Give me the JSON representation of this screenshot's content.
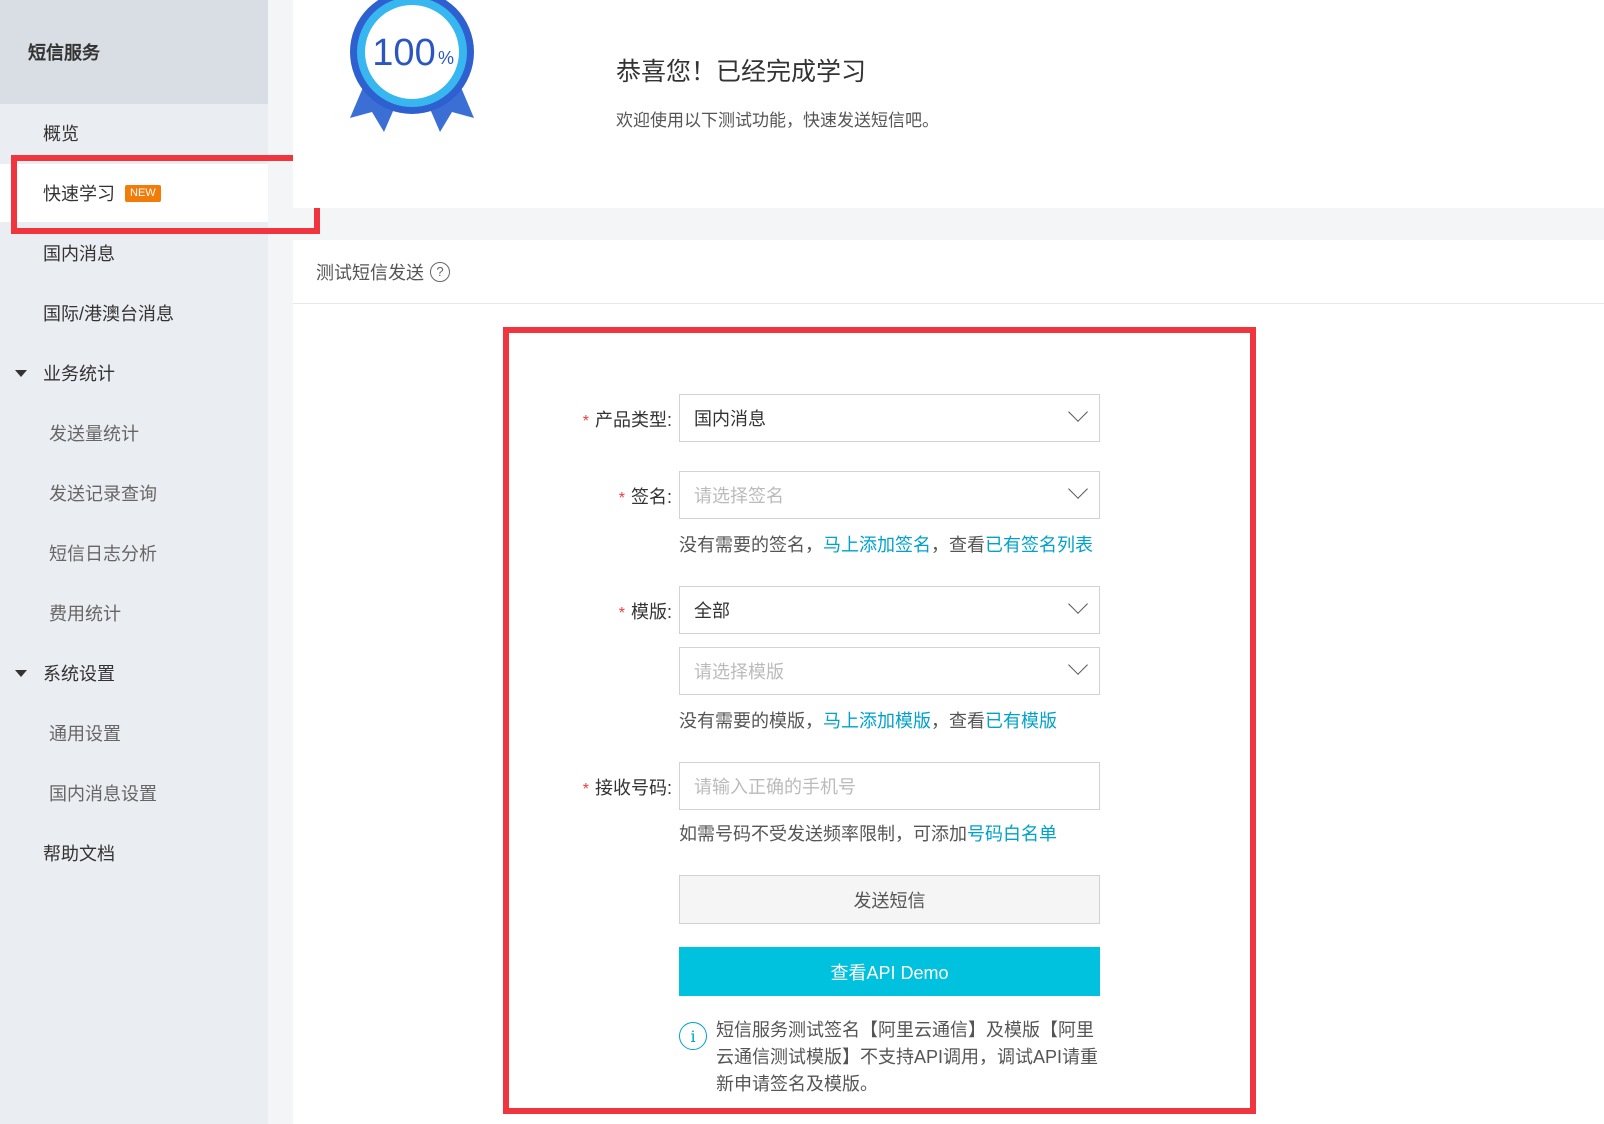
{
  "sidebar": {
    "title": "短信服务",
    "items": [
      {
        "label": "概览"
      },
      {
        "label": "快速学习",
        "badge": "NEW"
      },
      {
        "label": "国内消息"
      },
      {
        "label": "国际/港澳台消息"
      },
      {
        "label": "业务统计"
      },
      {
        "label": "发送量统计"
      },
      {
        "label": "发送记录查询"
      },
      {
        "label": "短信日志分析"
      },
      {
        "label": "费用统计"
      },
      {
        "label": "系统设置"
      },
      {
        "label": "通用设置"
      },
      {
        "label": "国内消息设置"
      },
      {
        "label": "帮助文档"
      }
    ]
  },
  "congrats": {
    "medal_text": "100",
    "medal_unit": "%",
    "title": "恭喜您！已经完成学习",
    "subtitle": "欢迎使用以下测试功能，快速发送短信吧。"
  },
  "test": {
    "header": "测试短信发送",
    "help_icon": "?",
    "required_mark": "*",
    "product_label": "产品类型:",
    "product_value": "国内消息",
    "sign_label": "签名:",
    "sign_placeholder": "请选择签名",
    "sign_hint_prefix": "没有需要的签名，",
    "sign_hint_link1": "马上添加签名",
    "sign_hint_mid": "，查看",
    "sign_hint_link2": "已有签名列表",
    "template_label": "模版:",
    "template_value": "全部",
    "template_placeholder": "请选择模版",
    "template_hint_prefix": "没有需要的模版，",
    "template_hint_link1": "马上添加模版",
    "template_hint_mid": "，查看",
    "template_hint_link2": "已有模版",
    "phone_label": "接收号码:",
    "phone_placeholder": "请输入正确的手机号",
    "phone_hint_prefix": "如需号码不受发送频率限制，可添加",
    "phone_hint_link": "号码白名单",
    "send_button": "发送短信",
    "api_button": "查看API Demo",
    "info_icon": "i",
    "info_text": "短信服务测试签名【阿里云通信】及模版【阿里云通信测试模版】不支持API调用，调试API请重新申请签名及模版。"
  },
  "colors": {
    "accent": "#00c1de",
    "link": "#00a2ca",
    "highlight": "#f0353f",
    "badge": "#f27c0a"
  }
}
